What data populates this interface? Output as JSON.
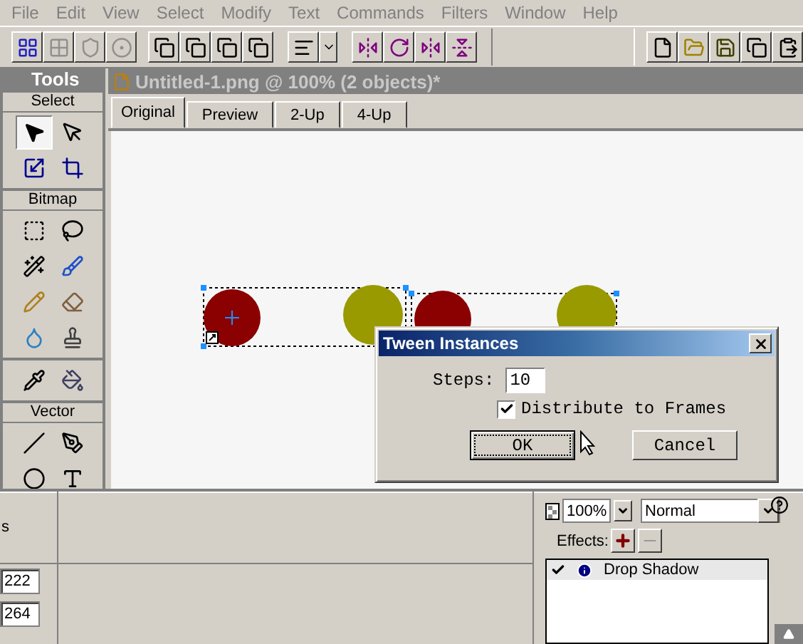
{
  "menu": [
    "File",
    "Edit",
    "View",
    "Select",
    "Modify",
    "Text",
    "Commands",
    "Filters",
    "Window",
    "Help"
  ],
  "tools": {
    "title": "Tools",
    "sections": [
      {
        "label": "Select",
        "tools": [
          {
            "selected": true
          },
          {
            "selected": false
          },
          {
            "selected": false
          },
          {
            "selected": false
          }
        ]
      },
      {
        "label": "Bitmap",
        "tools": [
          {
            "selected": false
          },
          {
            "selected": false
          },
          {
            "selected": false
          },
          {
            "selected": false
          },
          {
            "selected": false
          },
          {
            "selected": false
          },
          {
            "selected": false
          },
          {
            "selected": false
          }
        ]
      },
      {
        "tools": [
          {
            "selected": false
          },
          {
            "selected": false
          }
        ]
      },
      {
        "label": "Vector",
        "tools": [
          {
            "selected": false
          },
          {
            "selected": false
          },
          {
            "selected": false
          },
          {
            "selected": false
          }
        ]
      }
    ]
  },
  "document": {
    "title": "Untitled-1.png @  100% (2 objects)*",
    "tabs": [
      {
        "label": "Original",
        "selected": true
      },
      {
        "label": "Preview",
        "selected": false
      },
      {
        "label": "2-Up",
        "selected": false
      },
      {
        "label": "4-Up",
        "selected": false
      }
    ]
  },
  "dialog": {
    "title": "Tween Instances",
    "steps_label": "Steps:",
    "steps_value": "10",
    "distribute": {
      "label": "Distribute to Frames",
      "checked": true
    },
    "buttons": [
      {
        "label": "OK",
        "focused": true
      },
      {
        "label": "Cancel",
        "focused": false
      }
    ]
  },
  "properties": {
    "cut_label": "s",
    "fields": [
      "222",
      "264"
    ],
    "opacity": "100%",
    "blend_mode": "Normal",
    "effects_label": "Effects:",
    "effects": [
      {
        "label": "Drop Shadow",
        "checked": true
      }
    ]
  }
}
